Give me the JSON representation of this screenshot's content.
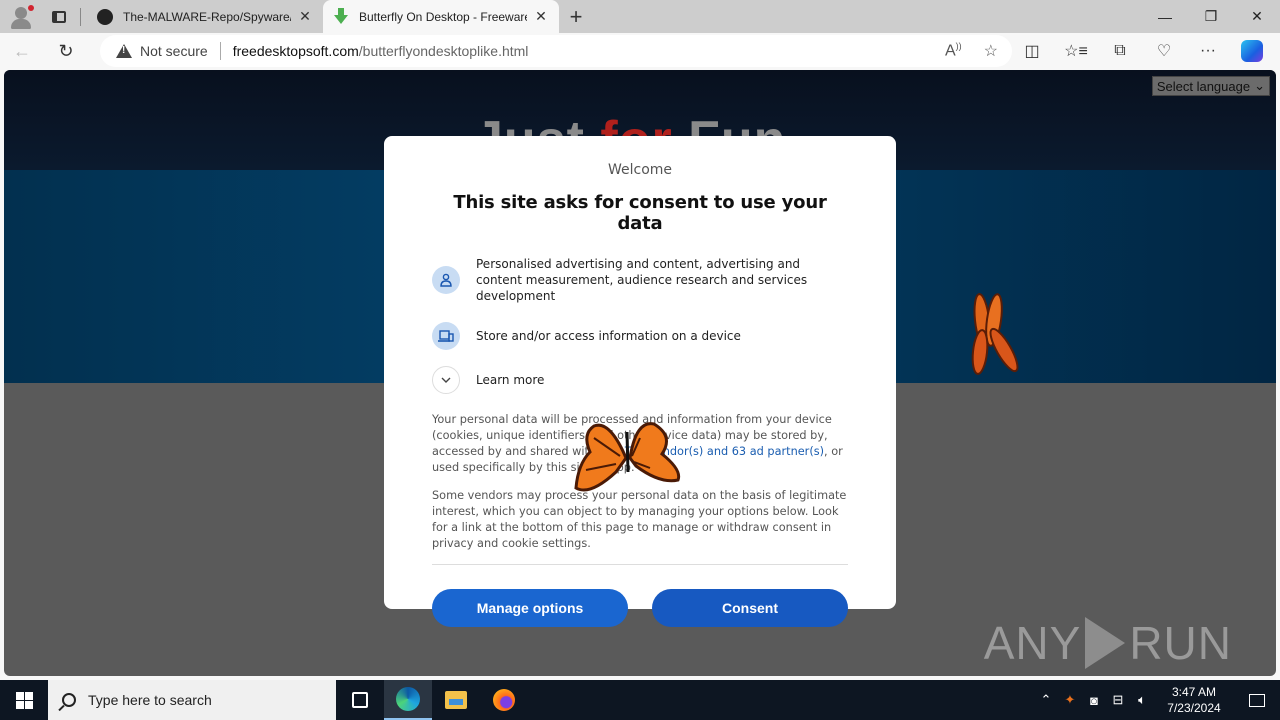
{
  "browser": {
    "tabs": [
      {
        "title": "The-MALWARE-Repo/Spyware/b",
        "icon": "github-icon",
        "active": false
      },
      {
        "title": "Butterfly On Desktop - Freeware",
        "icon": "download-icon",
        "active": true
      }
    ],
    "new_tab_label": "+",
    "window_controls": {
      "minimize": "—",
      "restore": "❐",
      "close": "✕"
    },
    "security_label": "Not secure",
    "url_host": "freedesktopsoft.com",
    "url_path": "/butterflyondesktoplike.html"
  },
  "page": {
    "hero_title_part1": "Just ",
    "hero_title_part2": "for",
    "hero_title_part3": " Fun",
    "language_select": "Select language",
    "watermark": {
      "left": "ANY",
      "right": "RUN"
    }
  },
  "consent": {
    "welcome": "Welcome",
    "title": "This site asks for consent to use your data",
    "purposes": [
      {
        "icon": "person-icon",
        "text": "Personalised advertising and content, advertising and content measurement, audience research and services development"
      },
      {
        "icon": "device-icon",
        "text": "Store and/or access information on a device"
      },
      {
        "icon": "chevron-down-icon",
        "text": "Learn more"
      }
    ],
    "para1_before": "Your personal data will be processed and information from your device (cookies, unique identifiers, and other device data) may be stored by, accessed by and shared with ",
    "para1_link": "135 TCF vendor(s) and 63 ad partner(s)",
    "para1_after": ", or used specifically by this site or app.",
    "para2": "Some vendors may process your personal data on the basis of legitimate interest, which you can object to by managing your options below. Look for a link at the bottom of this page to manage or withdraw consent in privacy and cookie settings.",
    "manage_button": "Manage options",
    "consent_button": "Consent"
  },
  "taskbar": {
    "search_placeholder": "Type here to search",
    "time": "3:47 AM",
    "date": "7/23/2024"
  }
}
